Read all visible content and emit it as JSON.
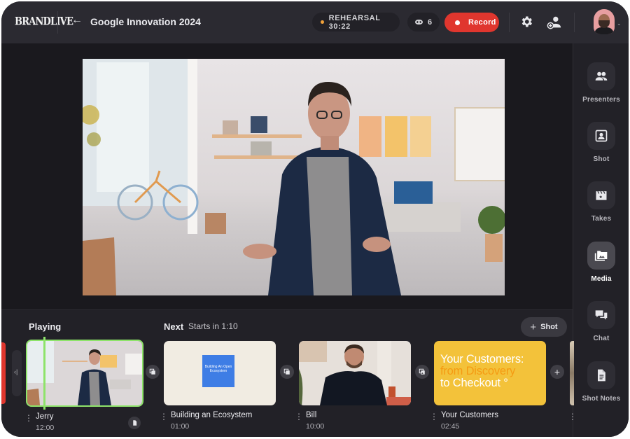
{
  "header": {
    "brand": "BRANDLIVE",
    "back_icon": "arrow-left-icon",
    "title": "Google Innovation 2024",
    "rehearsal_label": "REHEARSAL 30:22",
    "rehearsal_dot_color": "#f2a23a",
    "viewers_icon": "eye-icon",
    "viewers_count": "6",
    "record_label": "Record",
    "record_color": "#e0362e",
    "settings_icon": "gear-icon",
    "invite_icon": "add-user-icon",
    "avatar_icon": "user-avatar",
    "avatar_menu_icon": "chevron-down-icon"
  },
  "stage": {
    "program_feed": "Presenter video: man with glasses in a bright studio living room"
  },
  "sidebar": {
    "items": [
      {
        "label": "Presenters",
        "icon": "people-icon",
        "active": false
      },
      {
        "label": "Shot",
        "icon": "shot-frame-icon",
        "active": false
      },
      {
        "label": "Takes",
        "icon": "clapperboard-icon",
        "active": false
      },
      {
        "label": "Media",
        "icon": "media-folder-icon",
        "active": true
      },
      {
        "label": "Chat",
        "icon": "chat-bubbles-icon",
        "active": false
      },
      {
        "label": "Shot Notes",
        "icon": "document-icon",
        "active": false
      }
    ]
  },
  "timeline": {
    "playing_label": "Playing",
    "next_label": "Next",
    "next_starts": "Starts in 1:10",
    "add_shot_label": "Shot",
    "playhead_color": "#8ee36a",
    "shots": [
      {
        "name": "Jerry",
        "duration": "12:00",
        "state": "playing",
        "has_notes": true
      },
      {
        "name": "Building an Ecosystem",
        "duration": "01:00",
        "state": "next",
        "slide_text": "Building An Open Ecosystem"
      },
      {
        "name": "Bill",
        "duration": "10:00",
        "state": "queued"
      },
      {
        "name": "Your Customers",
        "duration": "02:45",
        "state": "queued",
        "slide_lines": [
          "Your Customers:",
          "from Discovery",
          "to Checkout °"
        ]
      }
    ]
  }
}
